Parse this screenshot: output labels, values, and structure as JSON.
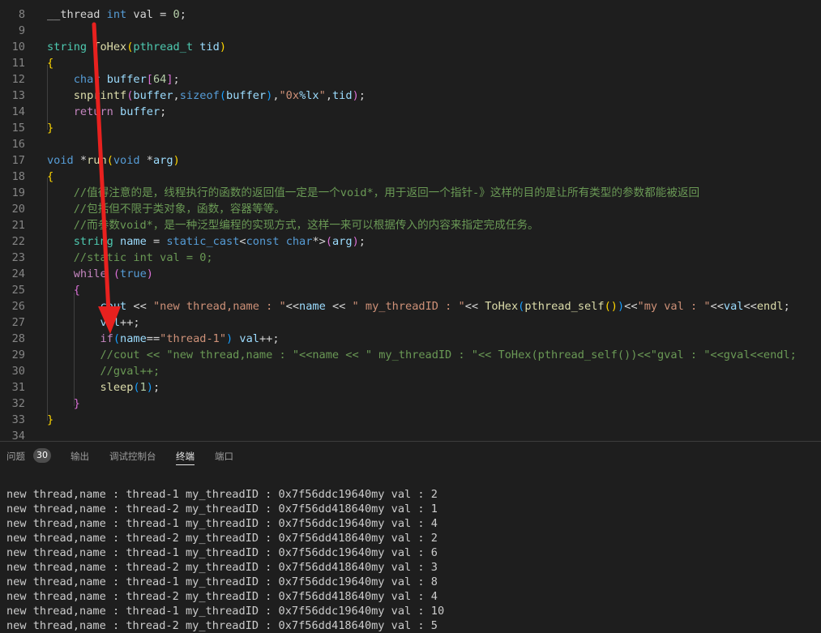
{
  "editor": {
    "lines": [
      {
        "n": "8",
        "tokens": [
          [
            "__thread ",
            "pl"
          ],
          [
            "int",
            "kw"
          ],
          [
            " val = ",
            "pl"
          ],
          [
            "0",
            "num"
          ],
          [
            ";",
            "pl"
          ]
        ]
      },
      {
        "n": "9",
        "tokens": []
      },
      {
        "n": "10",
        "tokens": [
          [
            "string",
            "type"
          ],
          [
            " ",
            "pl"
          ],
          [
            "ToHex",
            "fn"
          ],
          [
            "(",
            "p1"
          ],
          [
            "pthread_t",
            "type"
          ],
          [
            " tid",
            "var"
          ],
          [
            ")",
            "p1"
          ]
        ]
      },
      {
        "n": "11",
        "tokens": [
          [
            "{",
            "p1"
          ]
        ]
      },
      {
        "n": "12",
        "tokens": [
          [
            "    ",
            "pl"
          ],
          [
            "char",
            "kw"
          ],
          [
            " ",
            "pl"
          ],
          [
            "buffer",
            "var"
          ],
          [
            "[",
            "p2"
          ],
          [
            "64",
            "num"
          ],
          [
            "]",
            "p2"
          ],
          [
            ";",
            "pl"
          ]
        ]
      },
      {
        "n": "13",
        "tokens": [
          [
            "    ",
            "pl"
          ],
          [
            "snprintf",
            "fn"
          ],
          [
            "(",
            "p2"
          ],
          [
            "buffer",
            "var"
          ],
          [
            ",",
            "pl"
          ],
          [
            "sizeof",
            "kw"
          ],
          [
            "(",
            "p3"
          ],
          [
            "buffer",
            "var"
          ],
          [
            ")",
            "p3"
          ],
          [
            ",",
            "pl"
          ],
          [
            "\"0x",
            "str"
          ],
          [
            "%lx",
            "var"
          ],
          [
            "\"",
            "str"
          ],
          [
            ",",
            "pl"
          ],
          [
            "tid",
            "var"
          ],
          [
            ")",
            "p2"
          ],
          [
            ";",
            "pl"
          ]
        ]
      },
      {
        "n": "14",
        "tokens": [
          [
            "    ",
            "pl"
          ],
          [
            "return",
            "ctrl"
          ],
          [
            " ",
            "pl"
          ],
          [
            "buffer",
            "var"
          ],
          [
            ";",
            "pl"
          ]
        ]
      },
      {
        "n": "15",
        "tokens": [
          [
            "}",
            "p1"
          ]
        ]
      },
      {
        "n": "16",
        "tokens": []
      },
      {
        "n": "17",
        "tokens": [
          [
            "void",
            "kw"
          ],
          [
            " *",
            "pl"
          ],
          [
            "run",
            "fn"
          ],
          [
            "(",
            "p1"
          ],
          [
            "void",
            "kw"
          ],
          [
            " *",
            "pl"
          ],
          [
            "arg",
            "var"
          ],
          [
            ")",
            "p1"
          ]
        ]
      },
      {
        "n": "18",
        "tokens": [
          [
            "{",
            "p1"
          ]
        ]
      },
      {
        "n": "19",
        "tokens": [
          [
            "    ",
            "pl"
          ],
          [
            "//值得注意的是，线程执行的函数的返回值一定是一个void*，用于返回一个指针-》这样的目的是让所有类型的参数都能被返回",
            "cmt"
          ]
        ]
      },
      {
        "n": "20",
        "tokens": [
          [
            "    ",
            "pl"
          ],
          [
            "//包括但不限于类对象，函数，容器等等。",
            "cmt"
          ]
        ]
      },
      {
        "n": "21",
        "tokens": [
          [
            "    ",
            "pl"
          ],
          [
            "//而参数void*，是一种泛型编程的实现方式，这样一来可以根据传入的内容来指定完成任务。",
            "cmt"
          ]
        ]
      },
      {
        "n": "22",
        "tokens": [
          [
            "    ",
            "pl"
          ],
          [
            "string",
            "type"
          ],
          [
            " ",
            "pl"
          ],
          [
            "name",
            "var"
          ],
          [
            " = ",
            "pl"
          ],
          [
            "static_cast",
            "kw"
          ],
          [
            "<",
            "pl"
          ],
          [
            "const",
            "kw"
          ],
          [
            " ",
            "pl"
          ],
          [
            "char",
            "kw"
          ],
          [
            "*>",
            "pl"
          ],
          [
            "(",
            "p2"
          ],
          [
            "arg",
            "var"
          ],
          [
            ")",
            "p2"
          ],
          [
            ";",
            "pl"
          ]
        ]
      },
      {
        "n": "23",
        "tokens": [
          [
            "    ",
            "pl"
          ],
          [
            "//static int val = 0;",
            "cmt"
          ]
        ]
      },
      {
        "n": "24",
        "tokens": [
          [
            "    ",
            "pl"
          ],
          [
            "while",
            "ctrl"
          ],
          [
            " ",
            "pl"
          ],
          [
            "(",
            "p2"
          ],
          [
            "true",
            "kw"
          ],
          [
            ")",
            "p2"
          ]
        ]
      },
      {
        "n": "25",
        "tokens": [
          [
            "    ",
            "pl"
          ],
          [
            "{",
            "p2"
          ]
        ]
      },
      {
        "n": "26",
        "tokens": [
          [
            "        ",
            "pl"
          ],
          [
            "cout",
            "var"
          ],
          [
            " << ",
            "pl"
          ],
          [
            "\"new thread,name : \"",
            "str"
          ],
          [
            "<<",
            "pl"
          ],
          [
            "name",
            "var"
          ],
          [
            " << ",
            "pl"
          ],
          [
            "\" my_threadID : \"",
            "str"
          ],
          [
            "<< ",
            "pl"
          ],
          [
            "ToHex",
            "fn"
          ],
          [
            "(",
            "p3"
          ],
          [
            "pthread_self",
            "fn"
          ],
          [
            "()",
            "p1"
          ],
          [
            ")",
            "p3"
          ],
          [
            "<<",
            "pl"
          ],
          [
            "\"my val : \"",
            "str"
          ],
          [
            "<<",
            "pl"
          ],
          [
            "val",
            "var"
          ],
          [
            "<<",
            "pl"
          ],
          [
            "endl",
            "fn"
          ],
          [
            ";",
            "pl"
          ]
        ]
      },
      {
        "n": "27",
        "tokens": [
          [
            "        ",
            "pl"
          ],
          [
            "val",
            "var"
          ],
          [
            "++;",
            "pl"
          ]
        ]
      },
      {
        "n": "28",
        "tokens": [
          [
            "        ",
            "pl"
          ],
          [
            "if",
            "ctrl"
          ],
          [
            "(",
            "p3"
          ],
          [
            "name",
            "var"
          ],
          [
            "==",
            "pl"
          ],
          [
            "\"thread-1\"",
            "str"
          ],
          [
            ")",
            "p3"
          ],
          [
            " ",
            "pl"
          ],
          [
            "val",
            "var"
          ],
          [
            "++;",
            "pl"
          ]
        ]
      },
      {
        "n": "29",
        "tokens": [
          [
            "        ",
            "pl"
          ],
          [
            "//cout << \"new thread,name : \"<<name << \" my_threadID : \"<< ToHex(pthread_self())<<\"gval : \"<<gval<<endl;",
            "cmt"
          ]
        ]
      },
      {
        "n": "30",
        "tokens": [
          [
            "        ",
            "pl"
          ],
          [
            "//gval++;",
            "cmt"
          ]
        ]
      },
      {
        "n": "31",
        "tokens": [
          [
            "        ",
            "pl"
          ],
          [
            "sleep",
            "fn"
          ],
          [
            "(",
            "p3"
          ],
          [
            "1",
            "num"
          ],
          [
            ")",
            "p3"
          ],
          [
            ";",
            "pl"
          ]
        ]
      },
      {
        "n": "32",
        "tokens": [
          [
            "    ",
            "pl"
          ],
          [
            "}",
            "p2"
          ]
        ]
      },
      {
        "n": "33",
        "tokens": [
          [
            "}",
            "p1"
          ]
        ]
      },
      {
        "n": "34",
        "tokens": []
      }
    ]
  },
  "panel": {
    "tabs": [
      {
        "label": "问题",
        "name": "tab-problems",
        "active": false
      },
      {
        "label": "输出",
        "name": "tab-output",
        "active": false
      },
      {
        "label": "调试控制台",
        "name": "tab-debug-console",
        "active": false
      },
      {
        "label": "终端",
        "name": "tab-terminal",
        "active": true
      },
      {
        "label": "端口",
        "name": "tab-ports",
        "active": false
      }
    ],
    "problems_count": "30"
  },
  "terminal": {
    "lines": [
      "new thread,name : thread-1 my_threadID : 0x7f56ddc19640my val : 2",
      "new thread,name : thread-2 my_threadID : 0x7f56dd418640my val : 1",
      "new thread,name : thread-1 my_threadID : 0x7f56ddc19640my val : 4",
      "new thread,name : thread-2 my_threadID : 0x7f56dd418640my val : 2",
      "new thread,name : thread-1 my_threadID : 0x7f56ddc19640my val : 6",
      "new thread,name : thread-2 my_threadID : 0x7f56dd418640my val : 3",
      "new thread,name : thread-1 my_threadID : 0x7f56ddc19640my val : 8",
      "new thread,name : thread-2 my_threadID : 0x7f56dd418640my val : 4",
      "new thread,name : thread-1 my_threadID : 0x7f56ddc19640my val : 10",
      "new thread,name : thread-2 my_threadID : 0x7f56dd418640my val : 5"
    ]
  },
  "annotation": {
    "color": "#e8211f"
  }
}
